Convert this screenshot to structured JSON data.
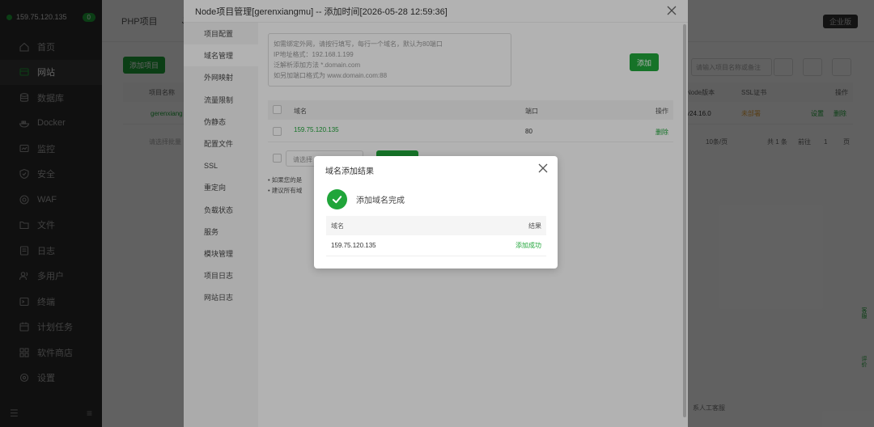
{
  "colors": {
    "accent": "#20a53a",
    "sidebar_bg": "#2c2c2c",
    "warn": "#e6a23c"
  },
  "sidebar": {
    "server_ip": "159.75.120.135",
    "badge": "0",
    "items": [
      {
        "label": "首页",
        "icon": "home-icon"
      },
      {
        "label": "网站",
        "icon": "website-icon"
      },
      {
        "label": "数据库",
        "icon": "database-icon"
      },
      {
        "label": "Docker",
        "icon": "docker-icon"
      },
      {
        "label": "监控",
        "icon": "monitor-icon"
      },
      {
        "label": "安全",
        "icon": "shield-icon"
      },
      {
        "label": "WAF",
        "icon": "waf-icon"
      },
      {
        "label": "文件",
        "icon": "folder-icon"
      },
      {
        "label": "日志",
        "icon": "log-icon"
      },
      {
        "label": "多用户",
        "icon": "users-icon"
      },
      {
        "label": "终端",
        "icon": "terminal-icon"
      },
      {
        "label": "计划任务",
        "icon": "calendar-icon"
      },
      {
        "label": "软件商店",
        "icon": "store-icon"
      },
      {
        "label": "设置",
        "icon": "gear-icon"
      }
    ]
  },
  "background": {
    "tab_php": "PHP项目",
    "tab_j": "J",
    "enterprise": "企业版",
    "add_project": "添加项目",
    "col_name": "项目名称",
    "col_node": "Node版本",
    "col_ssl": "SSL证书",
    "col_op": "操作",
    "row_name": "gerenxiang",
    "row_node": "v24.16.0",
    "row_ssl": "未部署",
    "row_set": "设置",
    "row_del": "删除",
    "search_placeholder": "请输入项目名称或备注",
    "page_size": "10条/页",
    "total": "共 1 条",
    "goto": "前往",
    "page_num": "1",
    "page_unit": "页",
    "bulk_placeholder": "请选择批量",
    "float_service": "客服",
    "float_review": "评价",
    "bottom_service": "系人工客服"
  },
  "node_dialog": {
    "title": "Node项目管理[gerenxiangmu] -- 添加时间[2026-05-28 12:59:36]",
    "nav": [
      "项目配置",
      "域名管理",
      "外网映射",
      "流量限制",
      "伪静态",
      "配置文件",
      "SSL",
      "重定向",
      "负载状态",
      "服务",
      "模块管理",
      "项目日志",
      "网站日志"
    ],
    "textarea_hints": [
      "如需绑定外网，请按行填写，每行一个域名，默认为80端口",
      "IP地址格式：192.168.1.199",
      "泛解析添加方法 *.domain.com",
      "如另加端口格式为 www.domain.com:88"
    ],
    "add_btn": "添加",
    "col_domain": "域名",
    "col_port": "端口",
    "col_op": "操作",
    "row_domain": "159.75.120.135",
    "row_port": "80",
    "row_del": "删除",
    "bulk_placeholder": "请选择",
    "tips": [
      "如果您的是",
      "建议所有域"
    ]
  },
  "result_dialog": {
    "title": "域名添加结果",
    "message": "添加域名完成",
    "col_domain": "域名",
    "col_result": "结果",
    "row_domain": "159.75.120.135",
    "row_result": "添加成功"
  }
}
